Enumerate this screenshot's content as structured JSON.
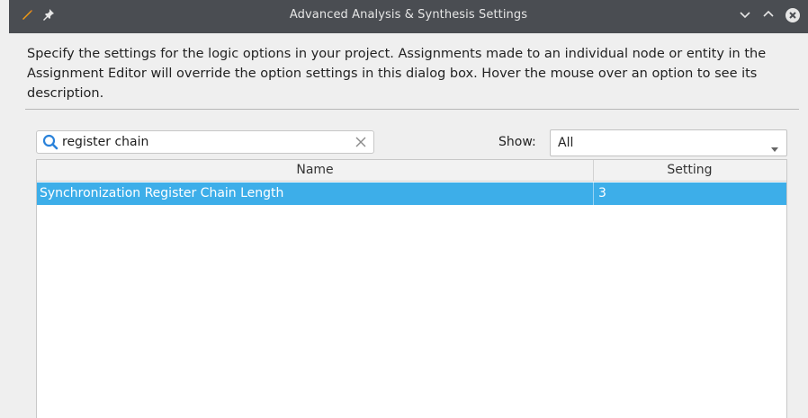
{
  "window": {
    "title": "Advanced Analysis & Synthesis Settings"
  },
  "description": "Specify the settings for the logic options in your project.  Assignments made to an individual node or entity in the Assignment Editor will override the option settings in this dialog box. Hover the mouse over an option to see its description.",
  "search": {
    "value": "register chain",
    "icon": "search-icon"
  },
  "filter": {
    "label": "Show:",
    "selected": "All"
  },
  "table": {
    "columns": [
      "Name",
      "Setting"
    ],
    "rows": [
      {
        "name": "Synchronization Register Chain Length",
        "setting": "3",
        "selected": true
      }
    ]
  },
  "colors": {
    "titlebar": "#4a4d52",
    "selection": "#3daee9",
    "accent_icon": "#2a82da"
  }
}
